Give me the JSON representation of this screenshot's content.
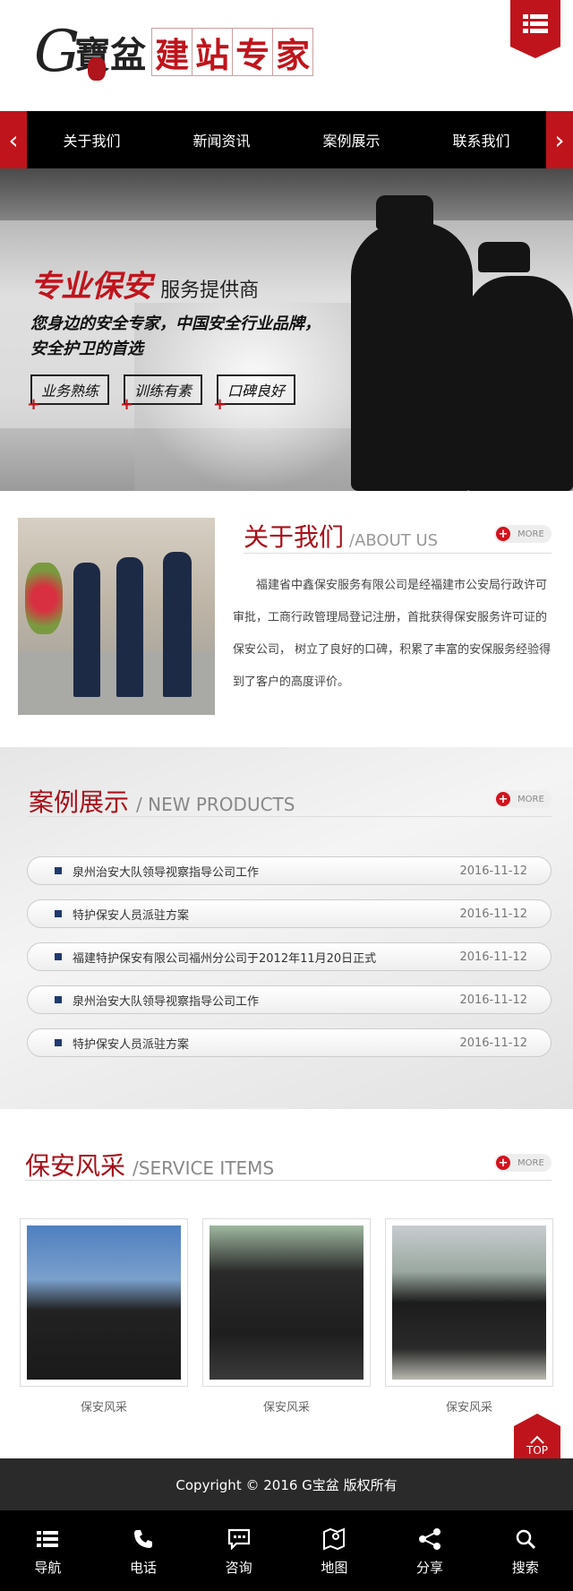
{
  "logo": {
    "letter": "G",
    "brand": "寶盆",
    "title_chars": [
      "建",
      "站",
      "专",
      "家"
    ]
  },
  "nav": {
    "prev": "‹",
    "next": "›",
    "items": [
      "关于我们",
      "新闻资讯",
      "案例展示",
      "联系我们"
    ]
  },
  "banner": {
    "headline_big": "专业保安",
    "headline_small": "服务提供商",
    "subline_1": "您身边的安全专家，中国安全行业品牌，",
    "subline_2": "安全护卫的首选",
    "tags": [
      "业务熟练",
      "训练有素",
      "口碑良好"
    ]
  },
  "about": {
    "title_zh": "关于我们",
    "title_en": "/ABOUT US",
    "more": "MORE",
    "text": "福建省中鑫保安服务有限公司是经福建市公安局行政许可审批，工商行政管理局登记注册，首批获得保安服务许可证的保安公司， 树立了良好的口碑，积累了丰富的安保服务经验得到了客户的高度评价。"
  },
  "cases": {
    "title_zh": "案例展示",
    "title_en": "/ NEW PRODUCTS",
    "more": "MORE",
    "items": [
      {
        "title": "泉州治安大队领导视察指导公司工作",
        "date": "2016-11-12"
      },
      {
        "title": "特护保安人员派驻方案",
        "date": "2016-11-12"
      },
      {
        "title": "福建特护保安有限公司福州分公司于2012年11月20日正式",
        "date": "2016-11-12"
      },
      {
        "title": "泉州治安大队领导视察指导公司工作",
        "date": "2016-11-12"
      },
      {
        "title": "特护保安人员派驻方案",
        "date": "2016-11-12"
      }
    ]
  },
  "service": {
    "title_zh": "保安风采",
    "title_en": "/SERVICE ITEMS",
    "more": "MORE",
    "captions": [
      "保安风采",
      "保安风采",
      "保安风采"
    ]
  },
  "top_button": "TOP",
  "footer": {
    "copyright": "Copyright © 2016 G宝盆 版权所有"
  },
  "bottom_nav": [
    "导航",
    "电话",
    "咨询",
    "地图",
    "分享",
    "搜索"
  ],
  "colors": {
    "accent": "#c0141c",
    "nav_bg": "#000000",
    "footer_bg": "#2a2a2a"
  }
}
